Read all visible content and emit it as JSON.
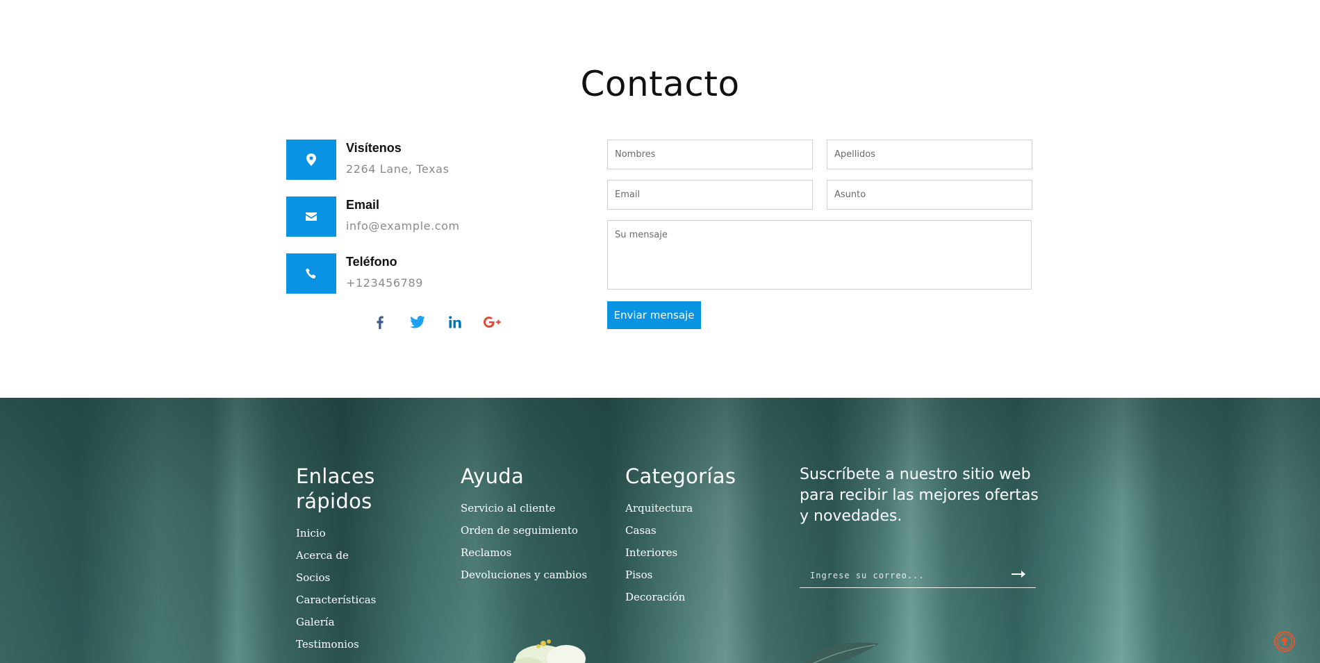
{
  "contact": {
    "title": "Contacto",
    "info": [
      {
        "label": "Visítenos",
        "value": "2264 Lane, Texas",
        "icon": "map-marker-icon"
      },
      {
        "label": "Email",
        "value": "info@example.com",
        "icon": "envelope-icon"
      },
      {
        "label": "Teléfono",
        "value": "+123456789",
        "icon": "phone-icon"
      }
    ],
    "socials": [
      "facebook-icon",
      "twitter-icon",
      "linkedin-icon",
      "google-plus-icon"
    ],
    "form": {
      "first_name_placeholder": "Nombres",
      "last_name_placeholder": "Apellidos",
      "email_placeholder": "Email",
      "subject_placeholder": "Asunto",
      "message_placeholder": "Su mensaje",
      "submit_label": "Enviar mensaje"
    },
    "colors": {
      "accent": "#0a93e3",
      "facebook": "#3b5998",
      "twitter": "#1da1f2",
      "linkedin": "#0077b5",
      "google": "#dd4b39"
    }
  },
  "footer": {
    "quick_links": {
      "title": "Enlaces rápidos",
      "items": [
        "Inicio",
        "Acerca de",
        "Socios",
        "Características",
        "Galería",
        "Testimonios"
      ]
    },
    "help": {
      "title": "Ayuda",
      "items": [
        "Servicio al cliente",
        "Orden de seguimiento",
        "Reclamos",
        "Devoluciones y cambios"
      ]
    },
    "categories": {
      "title": "Categorías",
      "items": [
        "Arquitectura",
        "Casas",
        "Interiores",
        "Pisos",
        "Decoración"
      ]
    },
    "subscribe": {
      "title": "Suscríbete a nuestro sitio web para recibir las mejores ofertas y novedades.",
      "placeholder": "Ingrese su correo...",
      "button_icon": "arrow-right-icon"
    },
    "back_to_top_icon": "arrow-up-circle-icon",
    "back_to_top_color": "#e4572e"
  }
}
